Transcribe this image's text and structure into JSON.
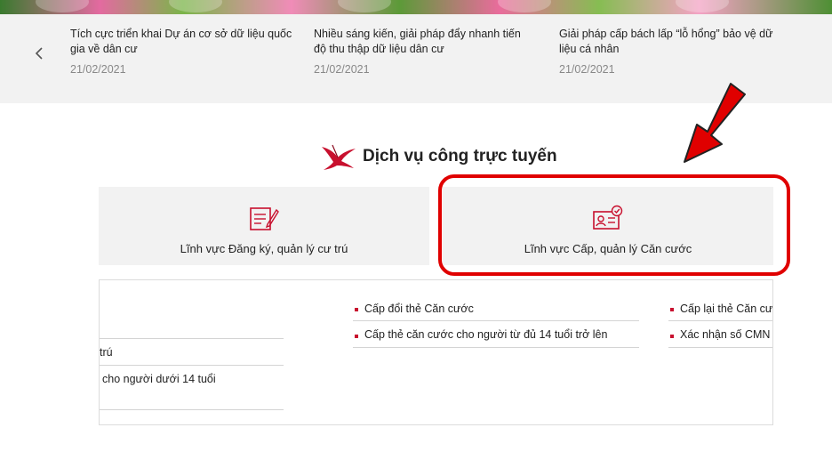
{
  "news": {
    "items": [
      {
        "title": "Tích cực triển khai Dự án cơ sở dữ liệu quốc gia về dân cư",
        "date": "21/02/2021"
      },
      {
        "title": "Nhiều sáng kiến, giải pháp đẩy nhanh tiến độ thu thập dữ liệu dân cư",
        "date": "21/02/2021"
      },
      {
        "title": "Giải pháp cấp bách lấp “lỗ hổng” bảo vệ dữ liệu cá nhân",
        "date": "21/02/2021"
      }
    ]
  },
  "section": {
    "title": "Dịch vụ công trực tuyến"
  },
  "tabs": [
    {
      "label": "Lĩnh vực Đăng ký, quản lý cư trú",
      "icon": "form-edit-icon"
    },
    {
      "label": "Lĩnh vực Cấp, quản lý Căn cước",
      "icon": "id-card-check-icon"
    }
  ],
  "services": {
    "left": [
      "trú",
      "cho người dưới 14 tuổi"
    ],
    "middle": [
      "Cấp đổi thẻ Căn cước",
      "Cấp thẻ căn cước cho người từ đủ 14 tuổi trở lên"
    ],
    "right": [
      "Cấp lại thẻ Căn cư",
      "Xác nhận số CMN"
    ]
  },
  "colors": {
    "accent": "#c8102e",
    "highlight": "#e00000"
  }
}
